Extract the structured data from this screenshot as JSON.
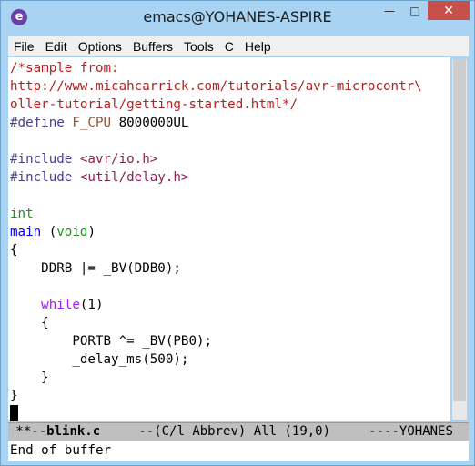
{
  "window": {
    "title": "emacs@YOHANES-ASPIRE"
  },
  "menu": [
    "File",
    "Edit",
    "Options",
    "Buffers",
    "Tools",
    "C",
    "Help"
  ],
  "code": {
    "line1": "/*sample from:",
    "line2": "http://www.micahcarrick.com/tutorials/avr-microcontr\\",
    "line3": "oller-tutorial/getting-started.html*/",
    "define_kw": "#define",
    "define_name": "F_CPU",
    "define_val": " 8000000UL",
    "include_kw": "#include",
    "include1": "<avr/io.h>",
    "include2": "<util/delay.h>",
    "int_kw": "int",
    "main_fn": "main",
    "main_open": " (",
    "void_kw": "void",
    "main_close": ")",
    "brace_open": "{",
    "ddrb_line": "    DDRB |= _BV(DDB0);",
    "while_indent": "    ",
    "while_kw": "while",
    "while_cond": "(1)",
    "inner_open": "    {",
    "portb_line": "        PORTB ^= _BV(PB0);",
    "delay_line": "        _delay_ms(500);",
    "inner_close": "    }",
    "brace_close": "}"
  },
  "modeline": {
    "prefix": " **--",
    "buffer": "blink.c",
    "rest": "     --(C/l Abbrev) All (19,0)     ----YOHANES"
  },
  "echo_area": "End of buffer"
}
